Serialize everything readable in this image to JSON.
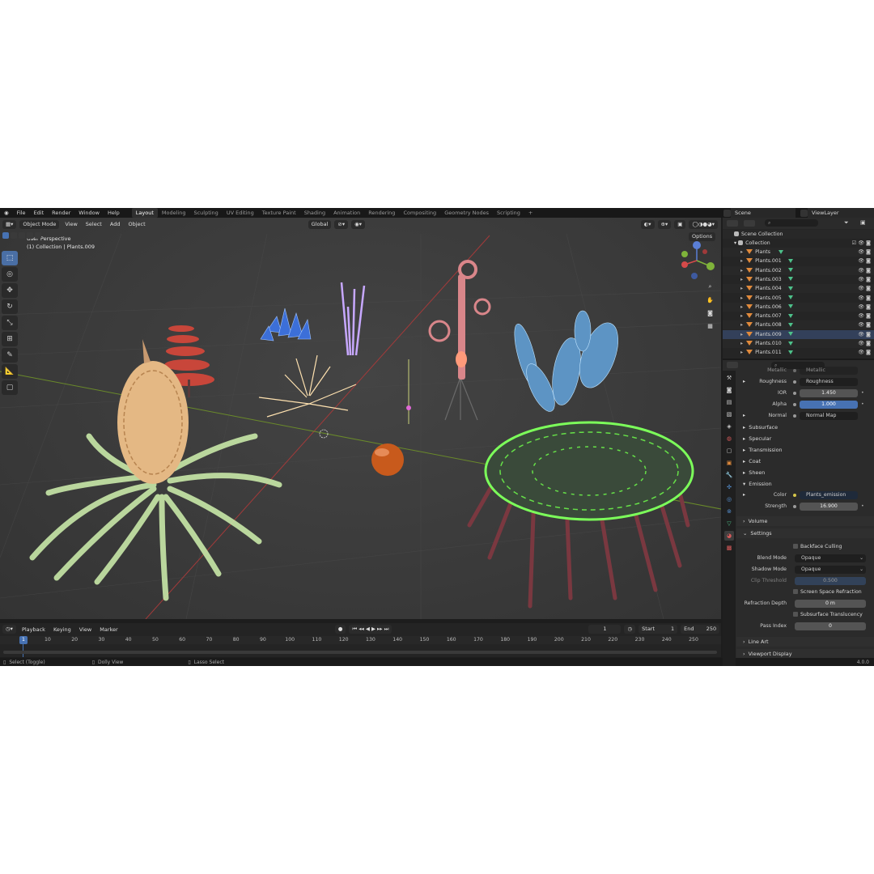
{
  "topbar": {
    "menus": [
      "File",
      "Edit",
      "Render",
      "Window",
      "Help"
    ],
    "workspaces": [
      "Layout",
      "Modeling",
      "Sculpting",
      "UV Editing",
      "Texture Paint",
      "Shading",
      "Animation",
      "Rendering",
      "Compositing",
      "Geometry Nodes",
      "Scripting"
    ],
    "add_tab": "+",
    "scene": "Scene",
    "view_layer": "ViewLayer"
  },
  "viewport": {
    "mode": "Object Mode",
    "menus": [
      "View",
      "Select",
      "Add",
      "Object"
    ],
    "orientation": "Global",
    "options": "Options",
    "overlay_title": "User Perspective",
    "overlay_subtitle": "(1) Collection | Plants.009"
  },
  "timeline": {
    "menus": [
      "Playback",
      "Keying",
      "View",
      "Marker"
    ],
    "current_frame": "1",
    "start_label": "Start",
    "start": "1",
    "end_label": "End",
    "end": "250",
    "ticks": [
      "1",
      "10",
      "20",
      "30",
      "40",
      "50",
      "60",
      "70",
      "80",
      "90",
      "100",
      "110",
      "120",
      "130",
      "140",
      "150",
      "160",
      "170",
      "180",
      "190",
      "200",
      "210",
      "220",
      "230",
      "240",
      "250"
    ]
  },
  "status": {
    "select": "Select (Toggle)",
    "dolly": "Dolly View",
    "lasso": "Lasso Select",
    "version": "4.0.0"
  },
  "outliner": {
    "scene_collection": "Scene Collection",
    "collection": "Collection",
    "items": [
      "Plants",
      "Plants.001",
      "Plants.002",
      "Plants.003",
      "Plants.004",
      "Plants.005",
      "Plants.006",
      "Plants.007",
      "Plants.008",
      "Plants.009",
      "Plants.010",
      "Plants.011"
    ],
    "selected": "Plants.009"
  },
  "properties": {
    "metallic_label": "Metallic",
    "metallic_value": "Metallic",
    "roughness_label": "Roughness",
    "roughness_value": "Roughness",
    "ior_label": "IOR",
    "ior_value": "1.450",
    "alpha_label": "Alpha",
    "alpha_value": "1.000",
    "normal_label": "Normal",
    "normal_value": "Normal Map",
    "subsurface": "Subsurface",
    "specular": "Specular",
    "transmission": "Transmission",
    "coat": "Coat",
    "sheen": "Sheen",
    "emission": "Emission",
    "color_label": "Color",
    "color_value": "Plants_emission",
    "strength_label": "Strength",
    "strength_value": "16.900",
    "volume": "Volume",
    "settings": "Settings",
    "backface_culling": "Backface Culling",
    "blend_mode_label": "Blend Mode",
    "blend_mode_value": "Opaque",
    "shadow_mode_label": "Shadow Mode",
    "shadow_mode_value": "Opaque",
    "clip_threshold_label": "Clip Threshold",
    "clip_threshold_value": "0.500",
    "screen_space_refraction": "Screen Space Refraction",
    "refraction_depth_label": "Refraction Depth",
    "refraction_depth_value": "0 m",
    "subsurface_translucency": "Subsurface Translucency",
    "pass_index_label": "Pass Index",
    "pass_index_value": "0",
    "line_art": "Line Art",
    "viewport_display": "Viewport Display"
  },
  "colors": {
    "accent": "#4772b3",
    "object_orange": "#e08a3c",
    "mesh_green": "#4dc18a"
  }
}
